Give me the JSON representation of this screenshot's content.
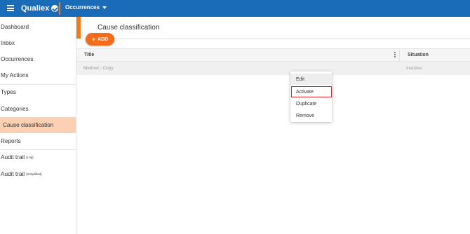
{
  "app": {
    "brand": "Qualiex",
    "module": "Occurrences",
    "accent_color": "#f07a1e",
    "topbar_color": "#1b6cb8"
  },
  "sidebar": {
    "items": [
      {
        "label": "Dashboard"
      },
      {
        "label": "Inbox"
      },
      {
        "label": "Occurrences"
      },
      {
        "label": "My Actions"
      },
      {
        "label": "Types"
      },
      {
        "label": "Categories"
      },
      {
        "label": "Cause classification",
        "active": true
      },
      {
        "label": "Reports"
      },
      {
        "label": "Audit trail",
        "sup": "(Log)"
      },
      {
        "label": "Audit trail",
        "sup": "(Simplified)"
      }
    ]
  },
  "page": {
    "title": "Cause classification",
    "add_label": "ADD"
  },
  "table": {
    "columns": [
      "Title",
      "Situation"
    ],
    "rows": [
      {
        "title": "Method - Copy",
        "situation": "Inactive"
      }
    ]
  },
  "context_menu": {
    "items": [
      {
        "label": "Edit",
        "state": "hover"
      },
      {
        "label": "Activate",
        "state": "highlighted"
      },
      {
        "label": "Duplicate"
      },
      {
        "label": "Remove"
      }
    ]
  },
  "icons": [
    "menu-icon",
    "qualiex-logo-icon",
    "chevron-down-icon",
    "plus-icon",
    "more-vert-icon"
  ]
}
